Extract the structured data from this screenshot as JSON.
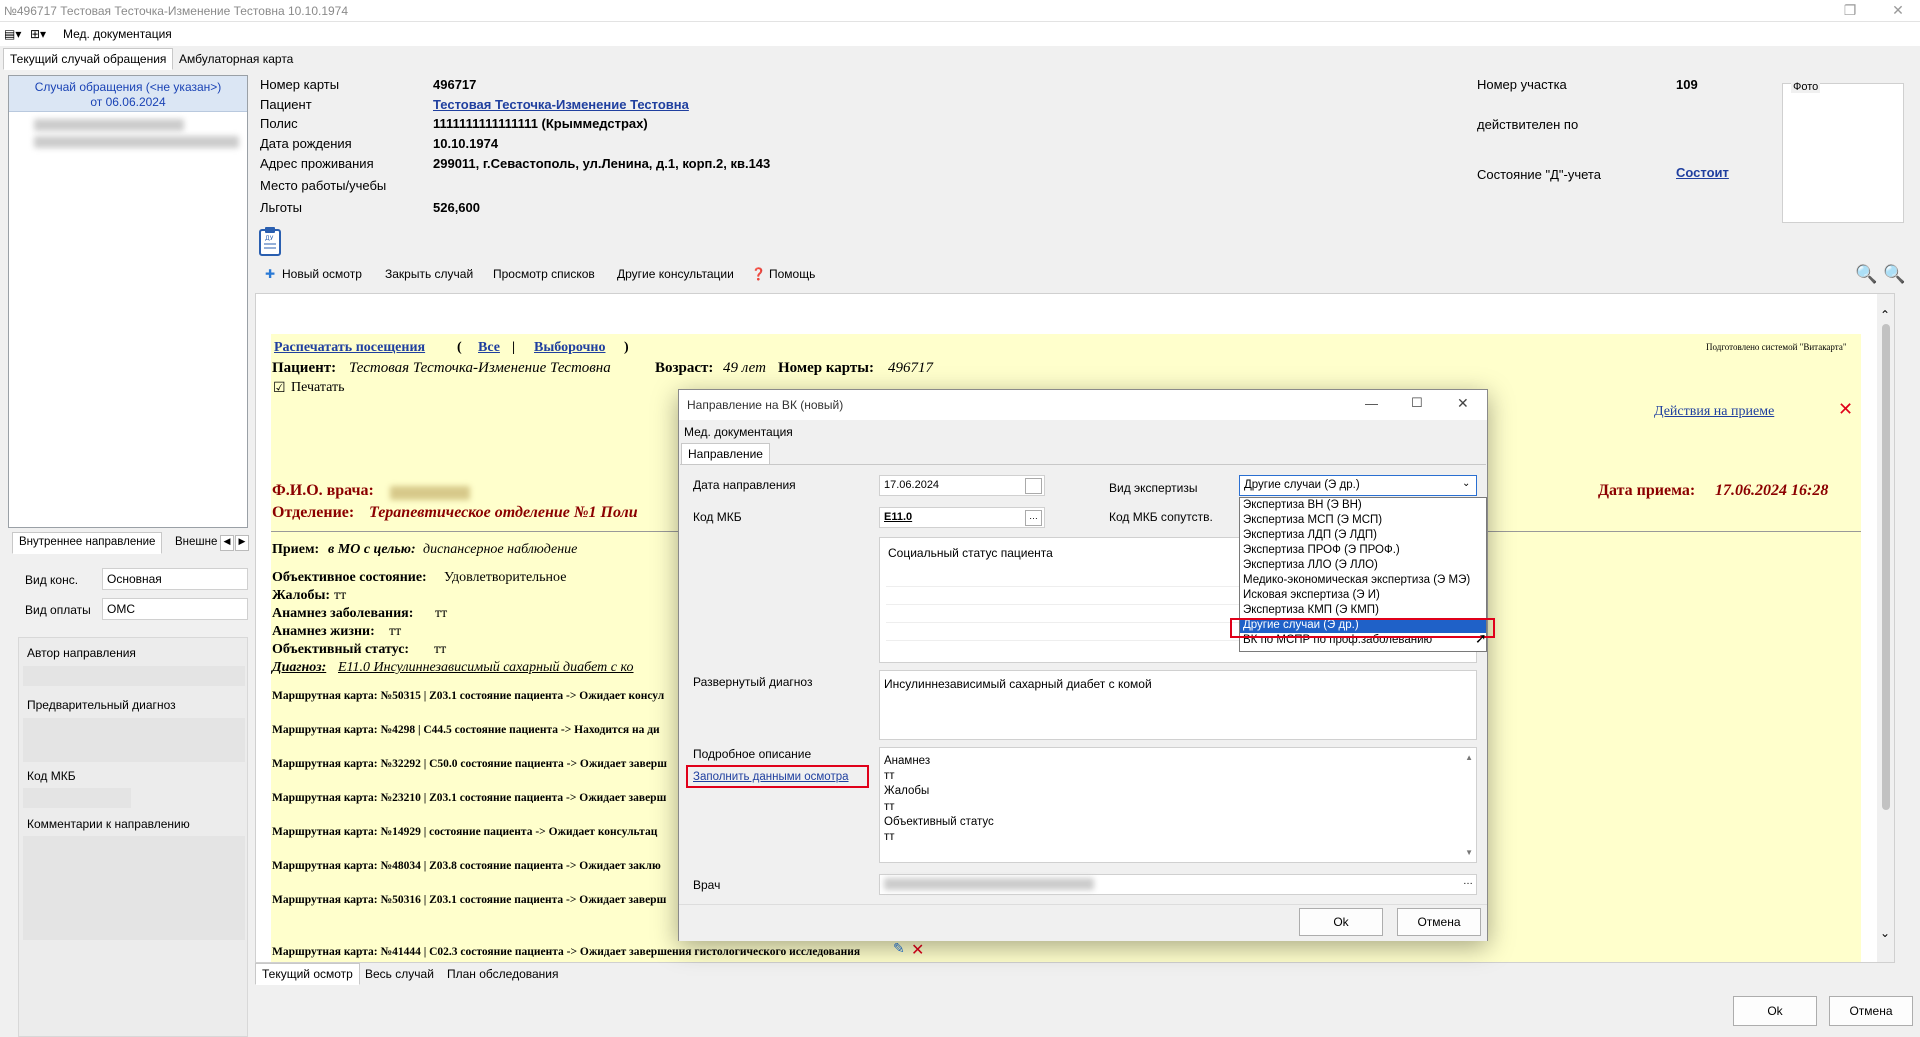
{
  "window": {
    "title": "№496717 Тестовая Тесточка-Изменение Тестовна 10.10.1974"
  },
  "menu": {
    "med_docs": "Мед. документация"
  },
  "tabs": [
    "Текущий случай обращения",
    "Амбулаторная карта"
  ],
  "case": {
    "header_line1": "Случай обращения (<не указан>)",
    "header_line2": "от 06.06.2024"
  },
  "left_tabs": [
    "Внутреннее направление",
    "Внешне"
  ],
  "left_form": {
    "vid_kons_label": "Вид конс.",
    "vid_kons_value": "Основная",
    "vid_oplaty_label": "Вид оплаты",
    "vid_oplaty_value": "ОМС",
    "avtor": "Автор направления",
    "predv": "Предварительный диагноз",
    "kod_mkb": "Код МКБ",
    "comment": "Комментарии к направлению"
  },
  "patient": {
    "card_label": "Номер карты",
    "card_value": "496717",
    "patient_label": "Пациент",
    "patient_value": "Тестовая Тесточка-Изменение Тестовна",
    "polis_label": "Полис",
    "polis_value": " 1111111111111111 (Крыммедстрах)",
    "dob_label": "Дата рождения",
    "dob_value": "10.10.1974",
    "addr_label": "Адрес проживания",
    "addr_value": "299011, г.Севастополь, ул.Ленина, д.1, корп.2, кв.143",
    "work_label": "Место работы/учебы",
    "lgoty_label": "Льготы",
    "lgoty_value": "526,600",
    "uchastok_label": "Номер участка",
    "uchastok_value": "109",
    "valid_label": "действителен по",
    "d_label": "Состояние \"Д\"-учета",
    "d_value": "Состоит",
    "foto_label": "Фото"
  },
  "toolbar": {
    "new": "Новый осмотр",
    "close": "Закрыть случай",
    "view": "Просмотр списков",
    "other": "Другие консультации",
    "help": "Помощь"
  },
  "report": {
    "print_visits": "Распечатать посещения",
    "all": "Все",
    "selective": "Выборочно",
    "prepared": "Подготовлено системой \"Витакарта\"",
    "patient_label": "Пациент:",
    "patient_name": "Тестовая Тесточка-Изменение Тестовна",
    "age_label": "Возраст:",
    "age": "49 лет",
    "card_label": "Номер карты:",
    "card": "496717",
    "print": "Печатать",
    "actions": "Действия на приеме",
    "doctor_label": "Ф.И.О. врача:",
    "dept_label": "Отделение:",
    "dept": "Терапевтическое отделение №1 Поли",
    "date_label": "Дата приема:",
    "date": "17.06.2024 16:28",
    "priem_label": "Прием:",
    "priem_mid": "в МО с целью:",
    "priem_val": "диспансерное наблюдение",
    "obj_label": "Объективное состояние:",
    "obj_val": "Удовлетворительное",
    "zhal_label": "Жалобы:",
    "zhal_val": "тт",
    "anz_label": "Анамнез заболевания:",
    "anz_val": "тт",
    "anzh_label": "Анамнез жизни:",
    "anzh_val": "тт",
    "objst_label": "Объективный статус:",
    "objst_val": "тт",
    "diag_label": "Диагноз:",
    "diag_val": "E11.0 Инсулиннезависимый сахарный диабет с ко",
    "routes": [
      "Маршрутная карта: №50315 | Z03.1 состояние пациента -> Ожидает консул",
      "Маршрутная карта: №4298 | C44.5 состояние пациента -> Находится на ди",
      "Маршрутная карта: №32292 | C50.0 состояние пациента -> Ожидает заверш",
      "Маршрутная карта: №23210 | Z03.1 состояние пациента -> Ожидает заверш",
      "Маршрутная карта: №14929 | состояние пациента -> Ожидает консультац",
      "Маршрутная карта: №48034 | Z03.8 состояние пациента -> Ожидает заклю",
      "Маршрутная карта: №50316 | Z03.1 состояние пациента -> Ожидает заверш",
      "Маршрутная карта: №41444 | C02.3 состояние пациента -> Ожидает завершения гистологического исследования"
    ]
  },
  "bottom_tabs": [
    "Текущий осмотр",
    "Весь случай",
    "План обследования"
  ],
  "footer": {
    "ok": "Ok",
    "cancel": "Отмена"
  },
  "dialog": {
    "title": "Направление на ВК (новый)",
    "med_docs": "Мед. документация",
    "tab": "Направление",
    "date_label": "Дата направления",
    "date_value": "17.06.2024",
    "mkb_label": "Код МКБ",
    "mkb_value": "E11.0",
    "vid_label": "Вид экспертизы",
    "vid_value": "Другие случаи (Э др.)",
    "mkb_sop_label": "Код МКБ сопутств.",
    "social": "Социальный статус пациента",
    "razv_label": "Развернутый диагноз",
    "razv_value": "Инсулиннезависимый сахарный диабет с комой",
    "podr_label": "Подробное описание",
    "fill_link": "Заполнить данными осмотра",
    "podr_lines": [
      "Анамнез",
      "тт",
      "Жалобы",
      "тт",
      "Объективный статус",
      "тт"
    ],
    "vrach_label": "Врач",
    "ok": "Ok",
    "cancel": "Отмена",
    "options": [
      "Экспертиза ВН (Э ВН)",
      "Экспертиза МСП (Э МСП)",
      "Экспертиза ЛДП (Э ЛДП)",
      "Экспертиза ПРОФ (Э ПРОФ.)",
      "Экспертиза ЛЛО (Э ЛЛО)",
      "Медико-экономическая экспертиза (Э МЭ)",
      "Исковая экспертиза (Э И)",
      "Экспертиза КМП (Э КМП)",
      "Другие случаи (Э др.)",
      "ВК по МСПР по проф.заболеванию"
    ]
  },
  "colors": {
    "link": "#1f3f9f",
    "highlight": "#e0001a",
    "selection": "#1f61c8",
    "report_bg": "#ffffcc",
    "heading_red": "#8b0000"
  }
}
